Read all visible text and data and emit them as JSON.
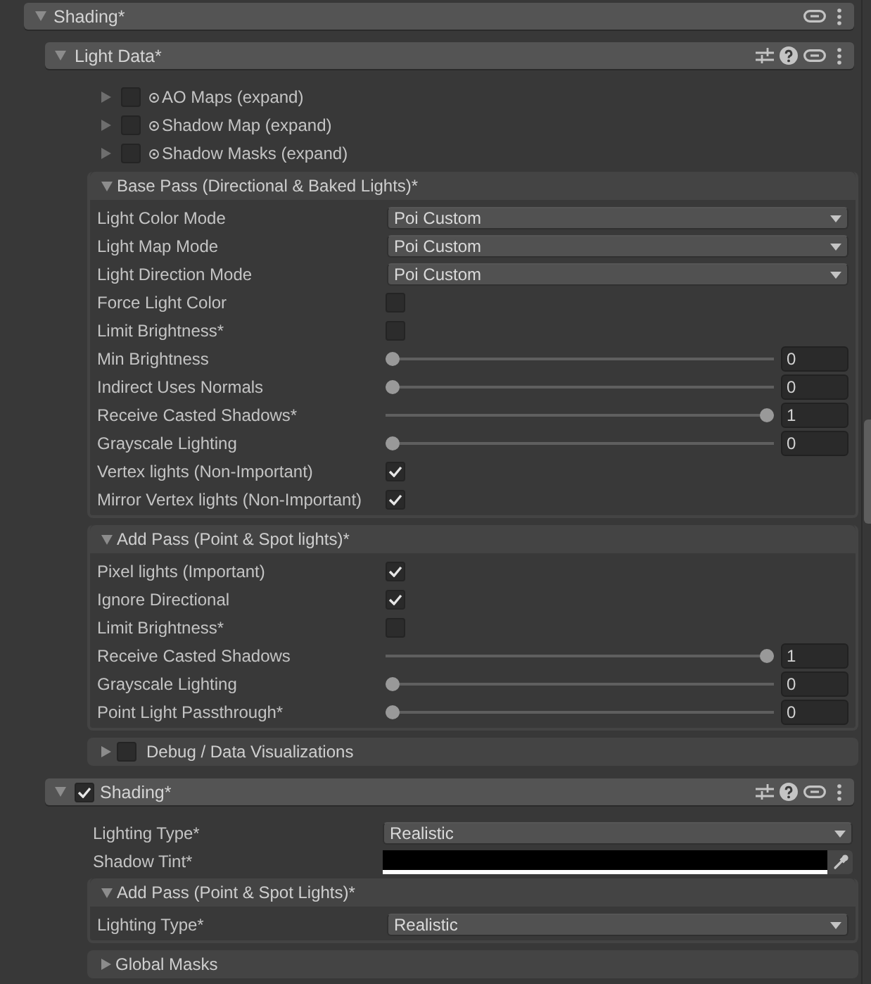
{
  "category": {
    "title": "Shading*",
    "expanded": true,
    "modules": [
      {
        "title": "Light Data*",
        "expanded": true,
        "items": [
          {
            "kind": "foldout",
            "label": "AO Maps (expand)",
            "expanded": false,
            "checked": false
          },
          {
            "kind": "foldout",
            "label": "Shadow Map (expand)",
            "expanded": false,
            "checked": false
          },
          {
            "kind": "foldout",
            "label": "Shadow Masks (expand)",
            "expanded": false,
            "checked": false
          },
          {
            "kind": "group",
            "title": "Base Pass (Directional & Baked Lights)*",
            "expanded": true,
            "rows": [
              {
                "kind": "dropdown",
                "label": "Light Color Mode",
                "value": "Poi Custom"
              },
              {
                "kind": "dropdown",
                "label": "Light Map Mode",
                "value": "Poi Custom"
              },
              {
                "kind": "dropdown",
                "label": "Light Direction Mode",
                "value": "Poi Custom"
              },
              {
                "kind": "checkbox",
                "label": "Force Light Color",
                "checked": false
              },
              {
                "kind": "checkbox",
                "label": "Limit Brightness*",
                "checked": false
              },
              {
                "kind": "slider",
                "label": "Min Brightness",
                "level": 0,
                "value": "0"
              },
              {
                "kind": "slider",
                "label": "Indirect Uses Normals",
                "level": 0,
                "value": "0"
              },
              {
                "kind": "slider",
                "label": "Receive Casted Shadows*",
                "level": 1,
                "value": "1"
              },
              {
                "kind": "slider",
                "label": "Grayscale Lighting",
                "level": 0,
                "value": "0"
              },
              {
                "kind": "checkbox",
                "label": "Vertex lights (Non-Important)",
                "checked": true
              },
              {
                "kind": "checkbox",
                "label": "Mirror Vertex lights (Non-Important)",
                "checked": true
              }
            ]
          },
          {
            "kind": "group",
            "title": "Add Pass (Point & Spot lights)*",
            "expanded": true,
            "rows": [
              {
                "kind": "checkbox",
                "label": "Pixel lights (Important)",
                "checked": true
              },
              {
                "kind": "checkbox",
                "label": "Ignore Directional",
                "checked": true
              },
              {
                "kind": "checkbox",
                "label": "Limit Brightness*",
                "checked": false
              },
              {
                "kind": "slider",
                "label": "Receive Casted Shadows",
                "level": 1,
                "value": "1"
              },
              {
                "kind": "slider",
                "label": "Grayscale Lighting",
                "level": 0,
                "value": "0"
              },
              {
                "kind": "slider",
                "label": "Point Light Passthrough*",
                "level": 0,
                "value": "0"
              }
            ]
          },
          {
            "kind": "group",
            "title": "Debug / Data Visualizations",
            "expanded": false,
            "checked": false
          }
        ]
      },
      {
        "title": "Shading*",
        "expanded": true,
        "checked": true,
        "items": [
          {
            "kind": "dropdown",
            "label": "Lighting Type*",
            "value": "Realistic"
          },
          {
            "kind": "color",
            "label": "Shadow Tint*",
            "color": "#000000"
          },
          {
            "kind": "group",
            "title": "Add Pass (Point & Spot Lights)*",
            "expanded": true,
            "rows": [
              {
                "kind": "dropdown",
                "label": "Lighting Type*",
                "value": "Realistic"
              }
            ]
          },
          {
            "kind": "group",
            "title": "Global Masks",
            "expanded": false
          }
        ]
      }
    ]
  }
}
